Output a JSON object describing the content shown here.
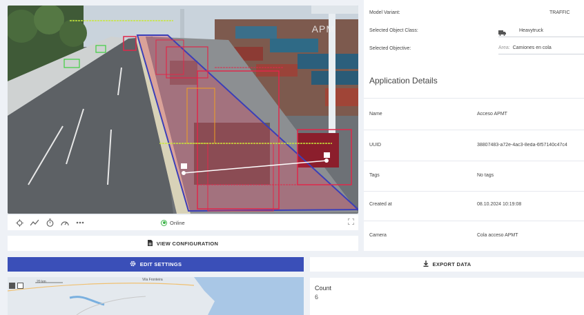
{
  "camera": {
    "overlay_text": "APM",
    "status": "Online",
    "controls": [
      "crosshair-icon",
      "trend-icon",
      "timer-icon",
      "speed-icon",
      "more-icon"
    ]
  },
  "actions": {
    "view_configuration": "VIEW CONFIGURATION",
    "edit_settings": "EDIT SETTINGS",
    "export_data": "EXPORT DATA"
  },
  "settings": {
    "model_variant_label": "Model Variant:",
    "model_variant_value": "TRAFFIC",
    "object_class_label": "Selected Object Class:",
    "object_class_value": "Heavytruck",
    "objective_label": "Selected Objective:",
    "objective_prefix": "Area:",
    "objective_value": "Camiones en cola"
  },
  "details": {
    "title": "Application Details",
    "rows": [
      {
        "label": "Name",
        "value": "Acceso APMT"
      },
      {
        "label": "UUID",
        "value": "38807483-a72e-4ac3-8eda-6f57140c47c4"
      },
      {
        "label": "Tags",
        "value": "No tags"
      },
      {
        "label": "Created at",
        "value": "08.10.2024 10:19:08"
      },
      {
        "label": "Camera",
        "value": "Cola acceso APMT"
      }
    ]
  },
  "map": {
    "scale_label": "20 km",
    "place_label": "Vila Fronteira"
  },
  "count": {
    "label": "Count",
    "value": "6"
  },
  "colors": {
    "accent": "#3a4fb8",
    "online": "#3fb54a",
    "detection": "#e0284a",
    "zone": "#3b3fb8"
  }
}
